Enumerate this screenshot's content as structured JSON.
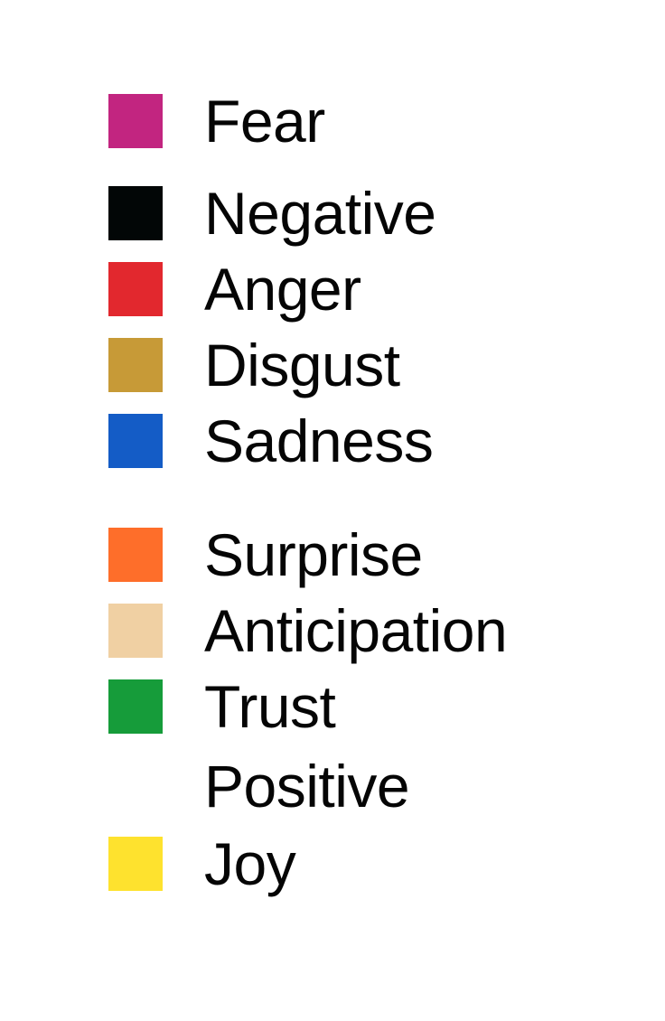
{
  "legend": {
    "items": [
      {
        "label": "Fear",
        "color": "#c22580"
      },
      {
        "label": "Negative",
        "color": "#020606"
      },
      {
        "label": "Anger",
        "color": "#e2282e"
      },
      {
        "label": "Disgust",
        "color": "#c79a37"
      },
      {
        "label": "Sadness",
        "color": "#145cc6"
      },
      {
        "label": "Surprise",
        "color": "#fe6e2a"
      },
      {
        "label": "Anticipation",
        "color": "#f0d0a3"
      },
      {
        "label": "Trust",
        "color": "#169c3a"
      },
      {
        "label": "Positive",
        "color": "#ffffff"
      },
      {
        "label": "Joy",
        "color": "#fee22e"
      }
    ]
  }
}
